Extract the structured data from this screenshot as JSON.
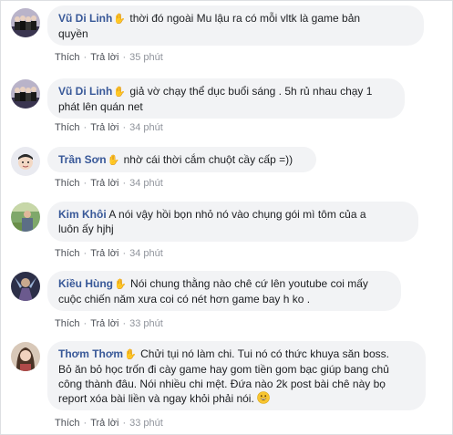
{
  "action_labels": {
    "like": "Thích",
    "reply": "Trả lời"
  },
  "comments": [
    {
      "author": "Vũ Di Linh",
      "lines": [
        "thời đó ngoài Mu lậu ra có mỗi vltk là game bản",
        "quyền"
      ],
      "time": "35 phút",
      "avatar_icon": "group-photo-avatar"
    },
    {
      "author": "Vũ Di Linh",
      "lines": [
        "giả vờ chạy thể dục buổi sáng . 5h rủ nhau chạy 1",
        "phát lên quán net"
      ],
      "time": "34 phút",
      "avatar_icon": "group-photo-avatar"
    },
    {
      "author": "Trần Sơn",
      "lines": [
        "nhờ cái thời cắm chuột cầy cấp =))"
      ],
      "time": "34 phút",
      "avatar_icon": "cartoon-face-avatar"
    },
    {
      "author": "Kim Khôi",
      "lines": [
        "A nói vậy hồi bọn nhỏ nó vào chụng gói mì tôm của a",
        "luôn ấy hjhj"
      ],
      "time": "34 phút",
      "avatar_icon": "outdoor-photo-avatar"
    },
    {
      "author": "Kiều Hùng",
      "lines": [
        "Nói chung thằng nào chê cứ lên youtube coi mấy",
        "cuộc chiến năm xưa coi có nét hơn game bay h ko ."
      ],
      "time": "33 phút",
      "avatar_icon": "game-art-avatar"
    },
    {
      "author": "Thơm Thơm",
      "lines": [
        "Chửi tụi nó làm chi. Tui nó có thức khuya săn boss.",
        "Bỏ ăn bỏ học trốn đi cày game hay gom tiền gom bạc giúp bang chủ",
        "công thành đâu. Nói nhiều chi mệt. Đứa nào 2k post bài chê này bọ",
        "report xóa bài liền và ngay khỏi phải nói."
      ],
      "time": "33 phút",
      "avatar_icon": "portrait-photo-avatar",
      "trailing_emoji": "grinning-emoji"
    }
  ]
}
